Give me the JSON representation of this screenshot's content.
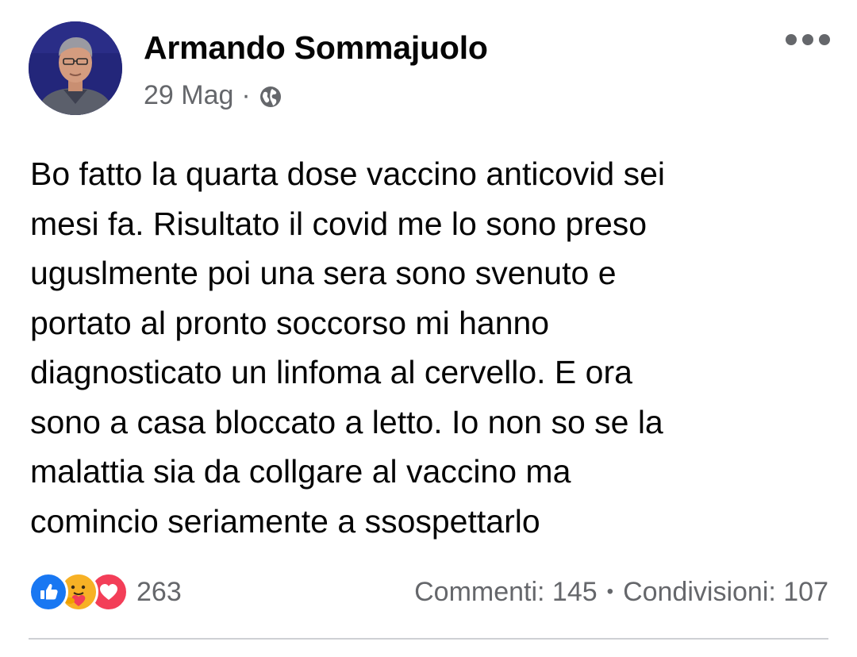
{
  "post": {
    "author": "Armando Sommajuolo",
    "date": "29 Mag",
    "meta_separator": "·",
    "privacy_icon": "globe-icon",
    "more_icon": "more-options-icon",
    "text_lines": [
      "Bo fatto la quarta dose vaccino anticovid sei",
      "mesi fa. Risultato il covid me lo sono preso",
      "uguslmente poi una sera sono svenuto e",
      "portato al pronto soccorso mi hanno",
      "diagnosticato un linfoma al cervello. E ora",
      "sono a casa bloccato a letto. Io non so se la",
      "malattia sia da collgare al vaccino ma",
      "comincio seriamente a ssospettarlo"
    ]
  },
  "reactions": {
    "icons": [
      "like-icon",
      "care-icon",
      "love-icon"
    ],
    "count": "263"
  },
  "stats": {
    "comments": "Commenti: 145",
    "separator": "•",
    "shares": "Condivisioni: 107"
  },
  "colors": {
    "text_primary": "#050505",
    "text_secondary": "#65676b",
    "like_blue": "#1877f2",
    "care_yellow": "#f7b125",
    "love_red": "#f33e58",
    "divider": "#ced0d4"
  }
}
